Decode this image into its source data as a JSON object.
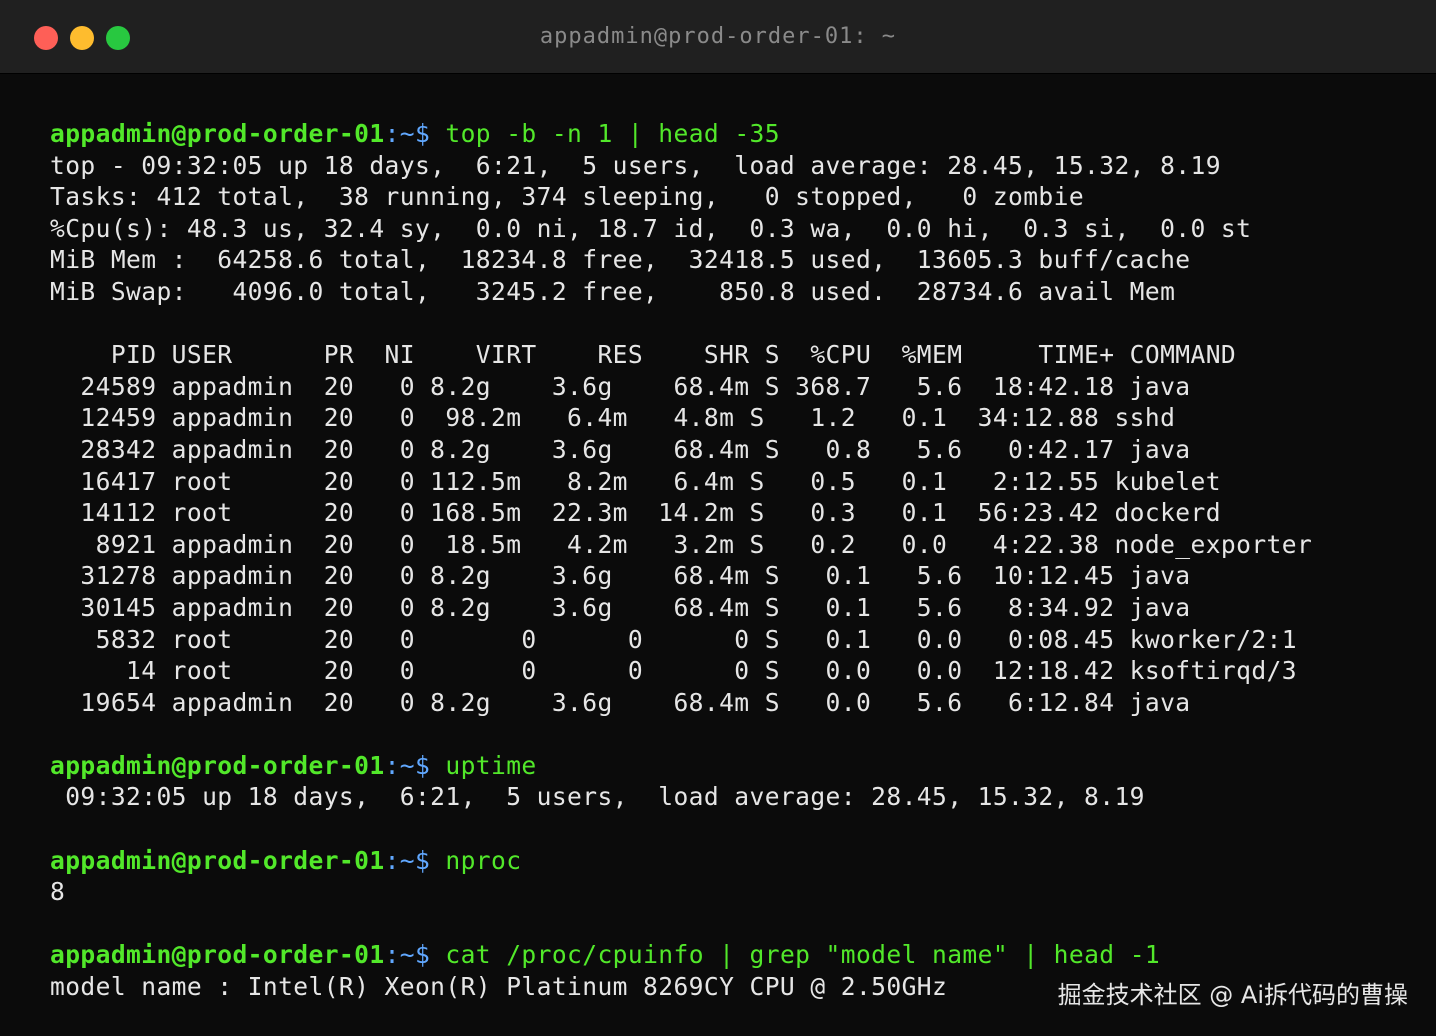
{
  "window": {
    "title": "appadmin@prod-order-01: ~"
  },
  "prompt": {
    "user_host": "appadmin@prod-order-01",
    "path": ":~$",
    "colors": {
      "user": "#52e82a",
      "path": "#61a8ff",
      "command": "#52e82a",
      "output": "#e6e6e6"
    }
  },
  "blocks": [
    {
      "command": " top -b -n 1 | head -35",
      "output": [
        "top - 09:32:05 up 18 days,  6:21,  5 users,  load average: 28.45, 15.32, 8.19",
        "Tasks: 412 total,  38 running, 374 sleeping,   0 stopped,   0 zombie",
        "%Cpu(s): 48.3 us, 32.4 sy,  0.0 ni, 18.7 id,  0.3 wa,  0.0 hi,  0.3 si,  0.0 st",
        "MiB Mem :  64258.6 total,  18234.8 free,  32418.5 used,  13605.3 buff/cache",
        "MiB Swap:   4096.0 total,   3245.2 free,    850.8 used.  28734.6 avail Mem",
        "",
        "    PID USER      PR  NI    VIRT    RES    SHR S  %CPU  %MEM     TIME+ COMMAND",
        "  24589 appadmin  20   0 8.2g    3.6g    68.4m S 368.7   5.6  18:42.18 java",
        "  12459 appadmin  20   0  98.2m   6.4m   4.8m S   1.2   0.1  34:12.88 sshd",
        "  28342 appadmin  20   0 8.2g    3.6g    68.4m S   0.8   5.6   0:42.17 java",
        "  16417 root      20   0 112.5m   8.2m   6.4m S   0.5   0.1   2:12.55 kubelet",
        "  14112 root      20   0 168.5m  22.3m  14.2m S   0.3   0.1  56:23.42 dockerd",
        "   8921 appadmin  20   0  18.5m   4.2m   3.2m S   0.2   0.0   4:22.38 node_exporter",
        "  31278 appadmin  20   0 8.2g    3.6g    68.4m S   0.1   5.6  10:12.45 java",
        "  30145 appadmin  20   0 8.2g    3.6g    68.4m S   0.1   5.6   8:34.92 java",
        "   5832 root      20   0       0      0      0 S   0.1   0.0   0:08.45 kworker/2:1",
        "     14 root      20   0       0      0      0 S   0.0   0.0  12:18.42 ksoftirqd/3",
        "  19654 appadmin  20   0 8.2g    3.6g    68.4m S   0.0   5.6   6:12.84 java"
      ]
    },
    {
      "command": " uptime",
      "output": [
        " 09:32:05 up 18 days,  6:21,  5 users,  load average: 28.45, 15.32, 8.19"
      ]
    },
    {
      "command": " nproc",
      "output": [
        "8"
      ]
    },
    {
      "command": " cat /proc/cpuinfo | grep \"model name\" | head -1",
      "output": [
        "model name : Intel(R) Xeon(R) Platinum 8269CY CPU @ 2.50GHz"
      ]
    }
  ],
  "watermark": "掘金技术社区 @ Ai拆代码的曹操"
}
